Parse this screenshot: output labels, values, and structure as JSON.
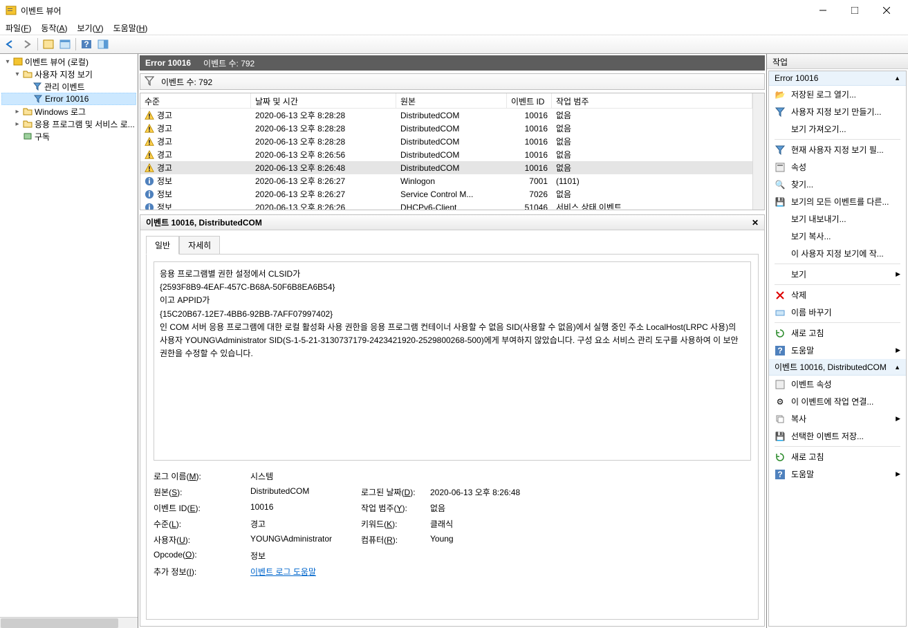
{
  "window": {
    "title": "이벤트 뷰어"
  },
  "menu": {
    "file": "파일(F)",
    "action": "동작(A)",
    "view": "보기(V)",
    "help": "도움말(H)"
  },
  "tree": {
    "root": "이벤트 뷰어 (로컬)",
    "custom_views": "사용자 지정 보기",
    "admin_events": "관리 이벤트",
    "error10016": "Error 10016",
    "windows_logs": "Windows 로그",
    "app_service_logs": "응용 프로그램 및 서비스 로...",
    "subscriptions": "구독"
  },
  "center": {
    "title": "Error 10016",
    "count_label": "이벤트 수: 792",
    "filter_count": "이벤트 수: 792"
  },
  "columns": {
    "level": "수준",
    "date": "날짜 및 시간",
    "source": "원본",
    "id": "이벤트 ID",
    "task": "작업 범주"
  },
  "events": [
    {
      "level": "경고",
      "type": "warn",
      "date": "2020-06-13 오후 8:28:28",
      "source": "DistributedCOM",
      "id": "10016",
      "task": "없음"
    },
    {
      "level": "경고",
      "type": "warn",
      "date": "2020-06-13 오후 8:28:28",
      "source": "DistributedCOM",
      "id": "10016",
      "task": "없음"
    },
    {
      "level": "경고",
      "type": "warn",
      "date": "2020-06-13 오후 8:28:28",
      "source": "DistributedCOM",
      "id": "10016",
      "task": "없음"
    },
    {
      "level": "경고",
      "type": "warn",
      "date": "2020-06-13 오후 8:26:56",
      "source": "DistributedCOM",
      "id": "10016",
      "task": "없음"
    },
    {
      "level": "경고",
      "type": "warn",
      "date": "2020-06-13 오후 8:26:48",
      "source": "DistributedCOM",
      "id": "10016",
      "task": "없음",
      "selected": true
    },
    {
      "level": "정보",
      "type": "info",
      "date": "2020-06-13 오후 8:26:27",
      "source": "Winlogon",
      "id": "7001",
      "task": "(1101)"
    },
    {
      "level": "정보",
      "type": "info",
      "date": "2020-06-13 오후 8:26:27",
      "source": "Service Control M...",
      "id": "7026",
      "task": "없음"
    },
    {
      "level": "정보",
      "type": "info",
      "date": "2020-06-13 오후 8:26:26",
      "source": "DHCPv6-Client",
      "id": "51046",
      "task": "서비스 상태 이벤트"
    }
  ],
  "detail": {
    "title": "이벤트 10016, DistributedCOM",
    "tab_general": "일반",
    "tab_details": "자세히",
    "desc_line1": "응용 프로그램별 권한 설정에서 CLSID가",
    "desc_line2": "{2593F8B9-4EAF-457C-B68A-50F6B8EA6B54}",
    "desc_line3": "이고 APPID가",
    "desc_line4": "{15C20B67-12E7-4BB6-92BB-7AFF07997402}",
    "desc_line5": "인 COM 서버 응용 프로그램에 대한 로컬 활성화 사용 권한을 응용 프로그램 컨테이너 사용할 수 없음 SID(사용할 수 없음)에서 실행 중인 주소 LocalHost(LRPC 사용)의 사용자 YOUNG\\Administrator SID(S-1-5-21-3130737179-2423421920-2529800268-500)에게 부여하지 않았습니다. 구성 요소 서비스 관리 도구를 사용하여 이 보안 권한을 수정할 수 있습니다.",
    "log_name_lbl": "로그 이름(M):",
    "log_name_val": "시스템",
    "source_lbl": "원본(S):",
    "source_val": "DistributedCOM",
    "logged_lbl": "로그된 날짜(D):",
    "logged_val": "2020-06-13 오후 8:26:48",
    "eventid_lbl": "이벤트 ID(E):",
    "eventid_val": "10016",
    "taskcat_lbl": "작업 범주(Y):",
    "taskcat_val": "없음",
    "level_lbl": "수준(L):",
    "level_val": "경고",
    "keywords_lbl": "키워드(K):",
    "keywords_val": "클래식",
    "user_lbl": "사용자(U):",
    "user_val": "YOUNG\\Administrator",
    "computer_lbl": "컴퓨터(R):",
    "computer_val": "Young",
    "opcode_lbl": "Opcode(O):",
    "opcode_val": "정보",
    "moreinfo_lbl": "추가 정보(I):",
    "moreinfo_link": "이벤트 로그 도움말"
  },
  "actions": {
    "header": "작업",
    "group1": "Error 10016",
    "open_saved_log": "저장된 로그 열기...",
    "create_custom_view": "사용자 지정 보기 만들기...",
    "import_view": "보기 가져오기...",
    "filter_current": "현재 사용자 지정 보기 필...",
    "properties": "속성",
    "find": "찾기...",
    "save_all_events": "보기의 모든 이벤트를 다른...",
    "export_view": "보기 내보내기...",
    "copy_view": "보기 복사...",
    "attach_task_view": "이 사용자 지정 보기에 작...",
    "view": "보기",
    "delete": "삭제",
    "rename": "이름 바꾸기",
    "refresh": "새로 고침",
    "help": "도움말",
    "group2": "이벤트 10016, DistributedCOM",
    "event_props": "이벤트 속성",
    "attach_task": "이 이벤트에 작업 연결...",
    "copy": "복사",
    "save_selected": "선택한 이벤트 저장...",
    "refresh2": "새로 고침",
    "help2": "도움말"
  }
}
